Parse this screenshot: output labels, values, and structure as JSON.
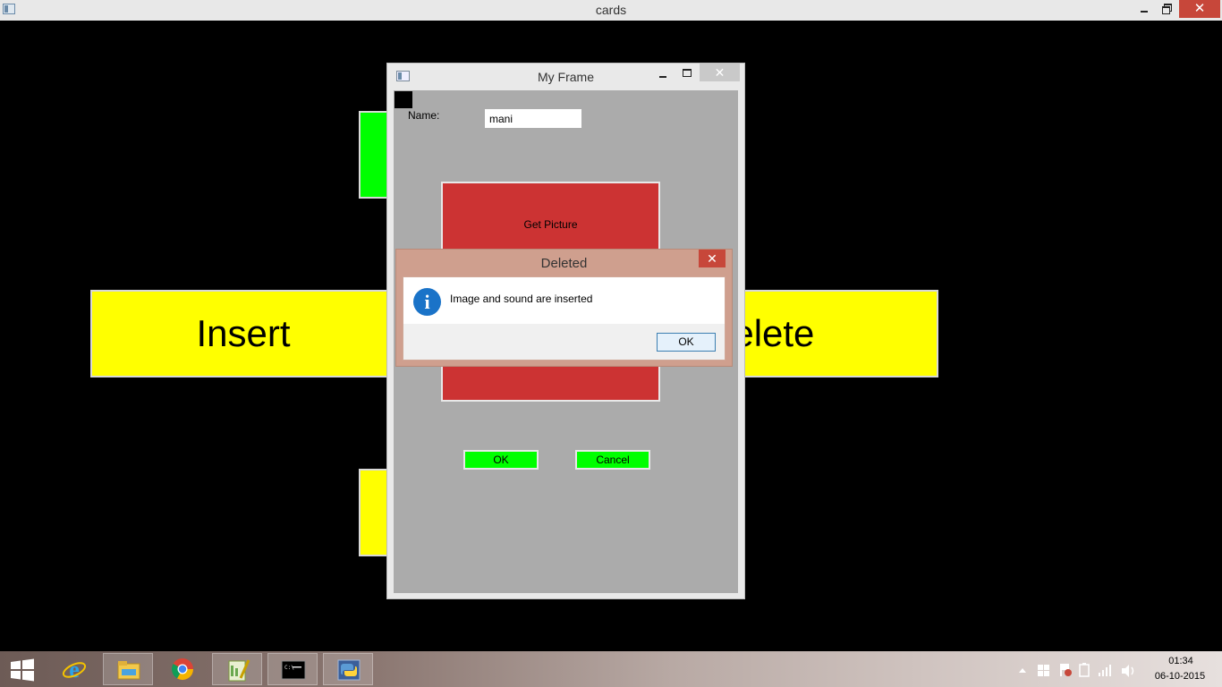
{
  "window": {
    "title": "cards",
    "close_glyph": "✕"
  },
  "main": {
    "insert_label": "Insert",
    "delete_label": "Delete"
  },
  "my_frame": {
    "title": "My Frame",
    "close_glyph": "✕",
    "name_label": "Name:",
    "name_value": "mani",
    "get_picture_label": "Get Picture",
    "ok_label": "OK",
    "cancel_label": "Cancel"
  },
  "dialog": {
    "title": "Deleted",
    "close_glyph": "✕",
    "message": "Image and sound are inserted",
    "ok_label": "OK",
    "icon": "info-icon",
    "icon_glyph": "i"
  },
  "taskbar": {
    "items": [
      "internet-explorer-icon",
      "file-explorer-icon",
      "chrome-icon",
      "notepad-plus-plus-icon",
      "command-prompt-icon",
      "python-icon"
    ],
    "time": "01:34",
    "date": "06-10-2015"
  },
  "colors": {
    "card_yellow": "#ffff00",
    "card_green": "#00ff00",
    "picture_red": "#cc3333",
    "close_red": "#c7473a",
    "info_blue": "#1a73c8"
  }
}
